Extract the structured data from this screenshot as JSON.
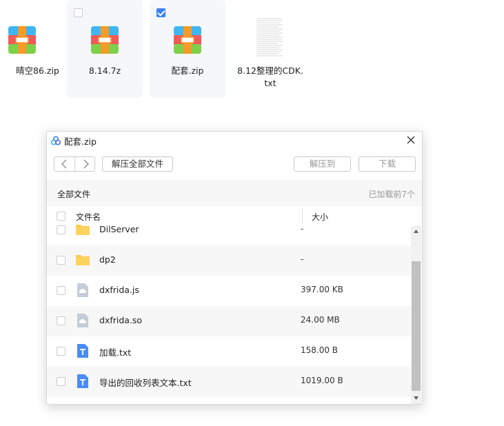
{
  "desktop_files": [
    {
      "label": "晴空86.zip",
      "type": "zip",
      "checked": false,
      "hover": false
    },
    {
      "label": "8.14.7z",
      "type": "zip",
      "checked": false,
      "hover": true
    },
    {
      "label": "配套.zip",
      "type": "zip",
      "checked": true,
      "hover": true
    },
    {
      "label": "8.12整理的CDK.\ntxt",
      "type": "txt",
      "checked": false,
      "hover": false
    }
  ],
  "dialog": {
    "title": "配套.zip",
    "toolbar": {
      "extract_all_label": "解压全部文件",
      "extract_to_label": "解压到",
      "download_label": "下载"
    },
    "breadcrumb": "全部文件",
    "loaded_text": "已加载前7个",
    "columns": {
      "name": "文件名",
      "size": "大小"
    },
    "rows": [
      {
        "name": "DilServer",
        "size": "-",
        "kind": "folder"
      },
      {
        "name": "dp2",
        "size": "-",
        "kind": "folder"
      },
      {
        "name": "dxfrida.js",
        "size": "397.00 KB",
        "kind": "generic"
      },
      {
        "name": "dxfrida.so",
        "size": "24.00 MB",
        "kind": "generic"
      },
      {
        "name": "加载.txt",
        "size": "158.00 B",
        "kind": "text"
      },
      {
        "name": "导出的回收列表文本.txt",
        "size": "1019.00 B",
        "kind": "text"
      }
    ]
  },
  "colors": {
    "accent": "#3b82f6",
    "folder": "#fcc84a",
    "text_icon": "#4a8cf7",
    "generic_icon": "#c4cdd8"
  }
}
